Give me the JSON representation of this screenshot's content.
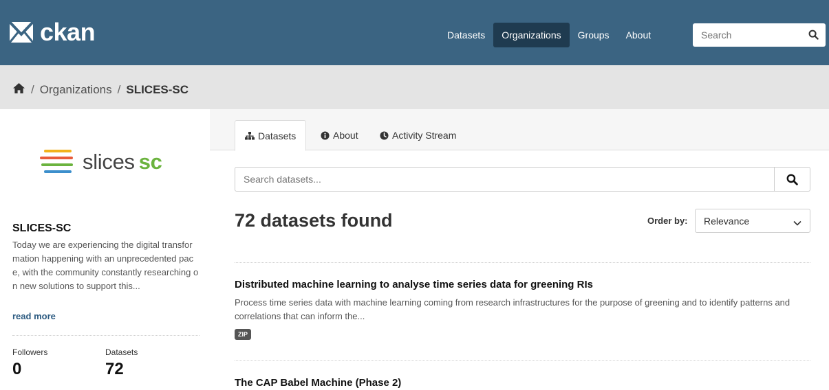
{
  "header": {
    "logo_text": "ckan",
    "nav": [
      {
        "label": "Datasets",
        "active": false
      },
      {
        "label": "Organizations",
        "active": true
      },
      {
        "label": "Groups",
        "active": false
      },
      {
        "label": "About",
        "active": false
      }
    ],
    "search_placeholder": "Search"
  },
  "breadcrumb": {
    "home_icon": "home-icon",
    "organizations": "Organizations",
    "current": "SLICES-SC",
    "separator": "/"
  },
  "sidebar": {
    "logo_word": "slices",
    "logo_suffix": "sc",
    "title": "SLICES-SC",
    "description": "Today we are experiencing the digital transformation happening with an unprecedented pace, with the community constantly researching on new solutions to support this...",
    "read_more": "read more",
    "followers_label": "Followers",
    "followers_value": "0",
    "datasets_label": "Datasets",
    "datasets_value": "72"
  },
  "tabs": [
    {
      "label": "Datasets",
      "icon": "sitemap-icon",
      "active": true
    },
    {
      "label": "About",
      "icon": "info-circle-icon",
      "active": false
    },
    {
      "label": "Activity Stream",
      "icon": "clock-icon",
      "active": false
    }
  ],
  "search": {
    "placeholder": "Search datasets..."
  },
  "results": {
    "count_text": "72 datasets found",
    "order_label": "Order by:",
    "order_value": "Relevance"
  },
  "datasets": [
    {
      "title": "Distributed machine learning to analyse time series data for greening RIs",
      "notes": "Process time series data with machine learning coming from research infrastructures for the purpose of greening and to identify patterns and correlations that can inform the...",
      "format": "ZIP"
    },
    {
      "title": "The CAP Babel Machine (Phase 2)"
    }
  ],
  "colors": {
    "masthead": "#3b6482",
    "nav_active": "#1f3b50",
    "toolbar": "#e4e4e4",
    "link": "#2e5c82",
    "logo_green": "#6bb33e"
  }
}
